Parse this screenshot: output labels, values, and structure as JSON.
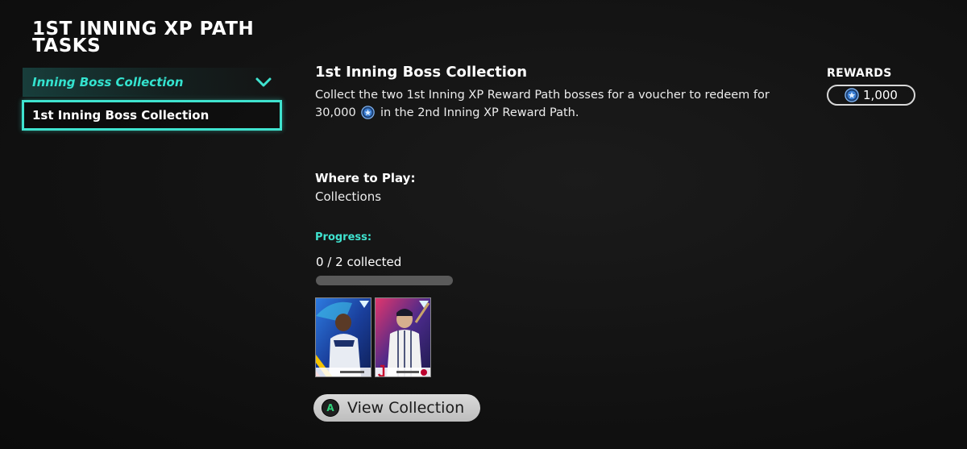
{
  "page": {
    "title": "1ST INNING XP PATH TASKS"
  },
  "sidebar": {
    "category": {
      "label": "Inning Boss Collection",
      "icon": "chevron-down-icon"
    },
    "items": [
      {
        "label": "1st Inning Boss Collection",
        "selected": true
      }
    ]
  },
  "task": {
    "title": "1st Inning Boss Collection",
    "description_before": "Collect the two 1st Inning XP Reward Path bosses for a voucher to redeem for 30,000",
    "description_after": "in the 2nd Inning XP Reward Path.",
    "currency_icon": "stubs-icon"
  },
  "rewards": {
    "title": "REWARDS",
    "amount": "1,000",
    "icon": "stubs-icon"
  },
  "where_to_play": {
    "title": "Where to Play:",
    "value": "Collections"
  },
  "progress": {
    "title": "Progress:",
    "text": "0 / 2 collected",
    "fraction": 0
  },
  "cards": [
    {
      "name": "player-card-1",
      "flag_colors": [
        "#f4c300",
        "#0033a0",
        "#cf142b"
      ]
    },
    {
      "name": "player-card-2",
      "flag_colors": [
        "#ffffff",
        "#bc002d",
        "#ffffff"
      ]
    }
  ],
  "view_collection": {
    "button_glyph": "A",
    "label": "View Collection"
  },
  "colors": {
    "accent": "#3fe3cf",
    "background": "#121212",
    "stubs": "#3a7fd5"
  }
}
